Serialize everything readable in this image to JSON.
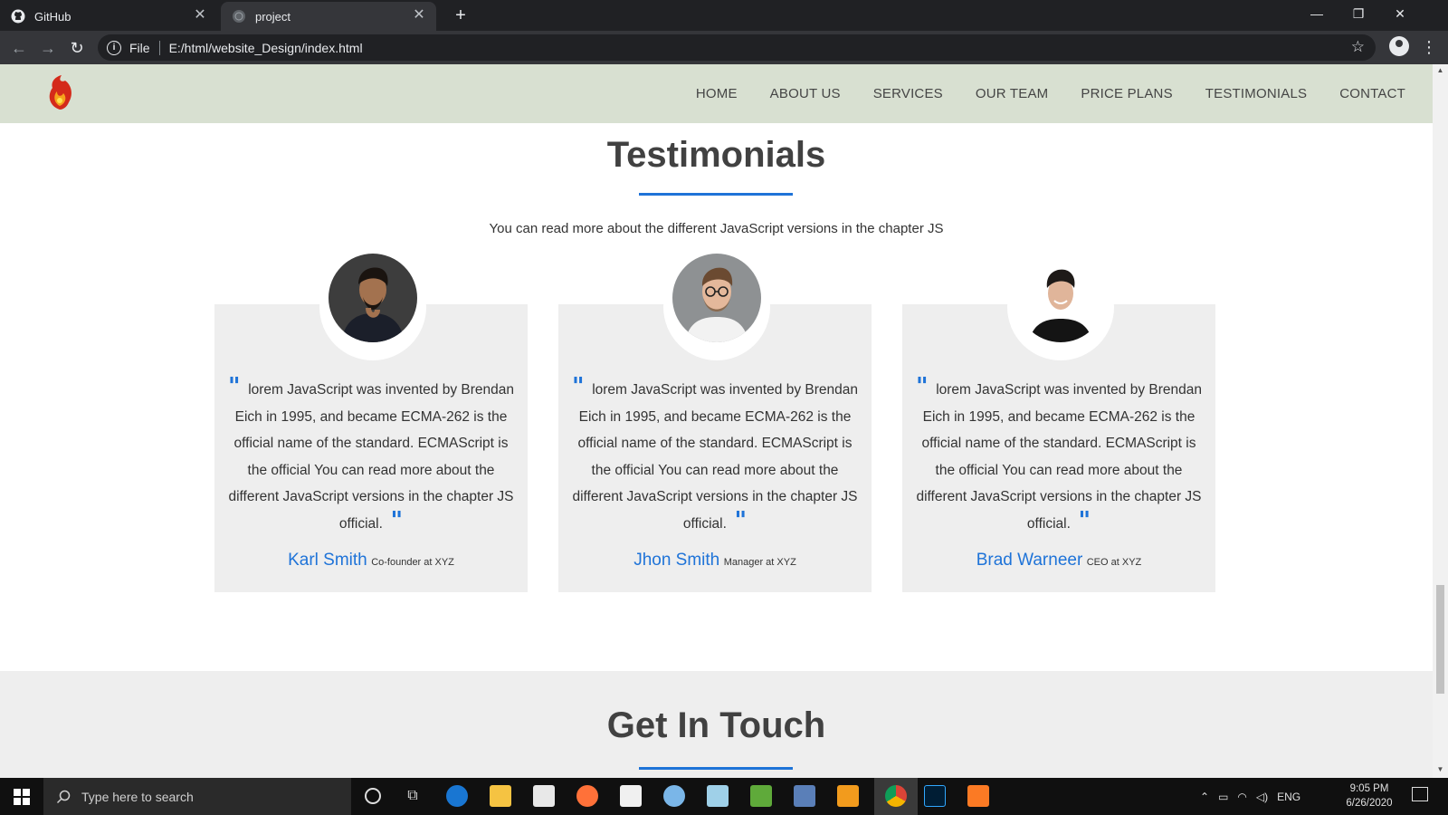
{
  "browser": {
    "tabs": [
      {
        "title": "GitHub",
        "icon": "github-icon"
      },
      {
        "title": "project",
        "icon": "globe-icon"
      }
    ],
    "address": {
      "scheme_label": "File",
      "url": "E:/html/website_Design/index.html"
    }
  },
  "site": {
    "nav": [
      "HOME",
      "ABOUT US",
      "SERVICES",
      "OUR TEAM",
      "PRICE PLANS",
      "TESTIMONIALS",
      "CONTACT"
    ],
    "testimonials": {
      "title": "Testimonials",
      "subtitle": "You can read more about the different JavaScript versions in the chapter JS",
      "cards": [
        {
          "quote": "lorem JavaScript was invented by Brendan Eich in 1995, and became ECMA-262 is the official name of the standard. ECMAScript is the official You can read more about the different JavaScript versions in the chapter JS official.",
          "name": "Karl Smith",
          "role": "Co-founder at XYZ"
        },
        {
          "quote": "lorem JavaScript was invented by Brendan Eich in 1995, and became ECMA-262 is the official name of the standard. ECMAScript is the official You can read more about the different JavaScript versions in the chapter JS official.",
          "name": "Jhon Smith",
          "role": "Manager at XYZ"
        },
        {
          "quote": "lorem JavaScript was invented by Brendan Eich in 1995, and became ECMA-262 is the official name of the standard. ECMAScript is the official You can read more about the different JavaScript versions in the chapter JS official.",
          "name": "Brad Warneer",
          "role": "CEO at XYZ"
        }
      ]
    },
    "contact": {
      "title": "Get In Touch"
    }
  },
  "taskbar": {
    "search_placeholder": "Type here to search",
    "lang": "ENG",
    "time": "9:05 PM",
    "date": "6/26/2020"
  },
  "colors": {
    "accent": "#1e73d8",
    "nav_bg": "#d8e0d1",
    "card_bg": "#eeeeee"
  }
}
